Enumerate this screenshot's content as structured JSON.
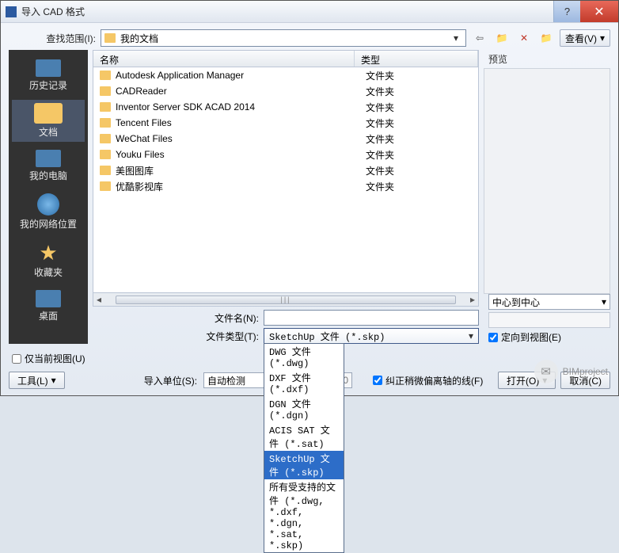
{
  "window": {
    "title": "导入 CAD 格式"
  },
  "labels": {
    "lookin": "查找范围(I):",
    "view": "查看(V)",
    "preview": "预览",
    "filename": "文件名(N):",
    "filetype": "文件类型(T):",
    "importunit": "导入单位(S):",
    "autodetect": "自动检测",
    "scalevalue": "1.000000",
    "currentview": "仅当前视图(U)",
    "tools": "工具(L)",
    "orient_check": "定向到视图(E)",
    "offaxis": "纠正稍微偏离轴的线(F)",
    "open": "打开(O)",
    "cancel": "取消(C)",
    "position_opt": "中心到中心"
  },
  "combo_current": "我的文档",
  "columns": {
    "name": "名称",
    "type": "类型"
  },
  "files": [
    {
      "name": "Autodesk Application Manager",
      "type": "文件夹"
    },
    {
      "name": "CADReader",
      "type": "文件夹"
    },
    {
      "name": "Inventor Server SDK ACAD 2014",
      "type": "文件夹"
    },
    {
      "name": "Tencent Files",
      "type": "文件夹"
    },
    {
      "name": "WeChat Files",
      "type": "文件夹"
    },
    {
      "name": "Youku Files",
      "type": "文件夹"
    },
    {
      "name": "美图图库",
      "type": "文件夹"
    },
    {
      "name": "优酷影视库",
      "type": "文件夹"
    }
  ],
  "sidebar": [
    {
      "label": "历史记录",
      "icon": "mon"
    },
    {
      "label": "文档",
      "icon": "folder",
      "sel": true
    },
    {
      "label": "我的电脑",
      "icon": "mon"
    },
    {
      "label": "我的网络位置",
      "icon": "globe"
    },
    {
      "label": "收藏夹",
      "icon": "star"
    },
    {
      "label": "桌面",
      "icon": "mon"
    }
  ],
  "filetype_selected": "SketchUp 文件 (*.skp)",
  "filetype_options": [
    "DWG 文件 (*.dwg)",
    "DXF 文件 (*.dxf)",
    "DGN 文件 (*.dgn)",
    "ACIS SAT 文件 (*.sat)",
    "SketchUp 文件 (*.skp)",
    "所有受支持的文件 (*.dwg, *.dxf, *.dgn, *.sat, *.skp)"
  ],
  "watermark": "BIMproject"
}
